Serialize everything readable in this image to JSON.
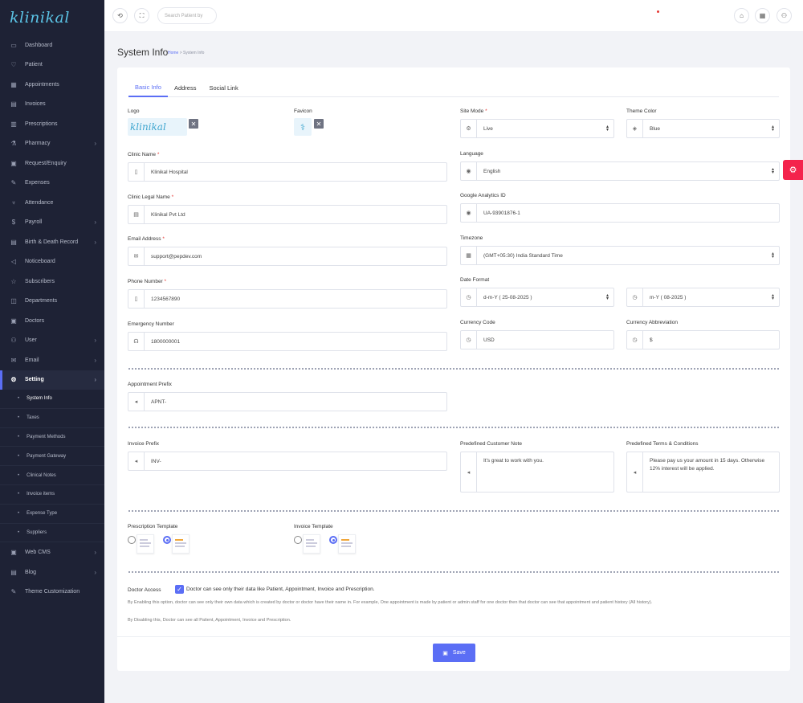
{
  "brand": {
    "name": "klinikal"
  },
  "sidebar": {
    "items": [
      {
        "label": "Dashboard",
        "icon": "monitor-icon",
        "glyph": "▭"
      },
      {
        "label": "Patient",
        "icon": "heart-icon",
        "glyph": "♡"
      },
      {
        "label": "Appointments",
        "icon": "calendar-icon",
        "glyph": "▦"
      },
      {
        "label": "Invoices",
        "icon": "invoice-icon",
        "glyph": "▤"
      },
      {
        "label": "Prescriptions",
        "icon": "prescription-icon",
        "glyph": "▥"
      },
      {
        "label": "Pharmacy",
        "icon": "pharmacy-icon",
        "glyph": "⚗",
        "chevron": true
      },
      {
        "label": "Request/Enquiry",
        "icon": "request-icon",
        "glyph": "▣"
      },
      {
        "label": "Expenses",
        "icon": "expenses-icon",
        "glyph": "✎"
      },
      {
        "label": "Attendance",
        "icon": "attendance-icon",
        "glyph": "♆"
      },
      {
        "label": "Payroll",
        "icon": "dollar-icon",
        "glyph": "$",
        "chevron": true
      },
      {
        "label": "Birth & Death Record",
        "icon": "record-icon",
        "glyph": "▤",
        "chevron": true
      },
      {
        "label": "Noticeboard",
        "icon": "megaphone-icon",
        "glyph": "◁"
      },
      {
        "label": "Subscribers",
        "icon": "star-icon",
        "glyph": "☆"
      },
      {
        "label": "Departments",
        "icon": "departments-icon",
        "glyph": "◫"
      },
      {
        "label": "Doctors",
        "icon": "doctor-icon",
        "glyph": "▣"
      },
      {
        "label": "User",
        "icon": "user-icon",
        "glyph": "⚇",
        "chevron": true
      },
      {
        "label": "Email",
        "icon": "mail-icon",
        "glyph": "✉",
        "chevron": true
      },
      {
        "label": "Setting",
        "icon": "gear-icon",
        "glyph": "⚙",
        "chevron": true,
        "active": true
      }
    ],
    "subitems": [
      "System Info",
      "Taxes",
      "Payment Methods",
      "Payment Gateway",
      "Clinical Notes",
      "Invoice items",
      "Expense Type",
      "Suppliers"
    ],
    "items_after": [
      {
        "label": "Web CMS",
        "icon": "web-icon",
        "glyph": "▣",
        "chevron": true
      },
      {
        "label": "Blog",
        "icon": "blog-icon",
        "glyph": "▤",
        "chevron": true
      },
      {
        "label": "Theme Customization",
        "icon": "theme-icon",
        "glyph": "✎"
      }
    ]
  },
  "topbar": {
    "search_placeholder": "Search Patient by"
  },
  "page": {
    "title": "System Info",
    "breadcrumb_home": "Home",
    "breadcrumb_sep": ">",
    "breadcrumb_current": "System Info"
  },
  "tabs": [
    "Basic Info",
    "Address",
    "Social Link"
  ],
  "form": {
    "logo_label": "Logo",
    "favicon_label": "Favicon",
    "site_mode_label": "Site Mode",
    "site_mode_value": "Live",
    "theme_color_label": "Theme Color",
    "theme_color_value": "Blue",
    "clinic_name_label": "Clinic Name",
    "clinic_name_value": "Klinikal Hospital",
    "language_label": "Language",
    "language_value": "English",
    "clinic_legal_label": "Clinic Legal Name",
    "clinic_legal_value": "Klinikal Pvt Ltd",
    "ga_label": "Google Analytics ID",
    "ga_value": "UA-93901876-1",
    "email_label": "Email Address",
    "email_value": "support@pepdev.com",
    "timezone_label": "Timezone",
    "timezone_value": "(GMT+05:30) India Standard Time",
    "phone_label": "Phone Number",
    "phone_value": "1234567890",
    "date_format_label": "Date Format",
    "date_format_value": "d-m-Y ( 25-08-2025 )",
    "date_format2_value": "m-Y ( 08-2025 )",
    "emergency_label": "Emergency Number",
    "emergency_value": "1800000001",
    "currency_code_label": "Currency Code",
    "currency_code_value": "USD",
    "currency_abbr_label": "Currency Abbreviation",
    "currency_abbr_value": "$",
    "appt_prefix_label": "Appointment Prefix",
    "appt_prefix_value": "APNT-",
    "invoice_prefix_label": "Invoice Prefix",
    "invoice_prefix_value": "INV-",
    "customer_note_label": "Predefined Customer Note",
    "customer_note_value": "It's great to work with you.",
    "terms_label": "Predefined Terms & Conditions",
    "terms_value": "Please pay us your amount in 15 days. Otherwise 12% interest will be applied.",
    "prescription_template_label": "Prescription Template",
    "invoice_template_label": "Invoice Template",
    "doctor_access_label": "Doctor Access",
    "doctor_access_check": "Doctor can see only their data like Patient, Appointment, Invoice and Prescription.",
    "help_enable": "By Enabling this option, doctor can see only their own data which is created by doctor or doctor have their name in. For example, One appointment is made by patient or admin staff for one doctor then that doctor can see that appointment and patient history (All history).",
    "help_disable": "By Disabling this, Doctor can see all Patient, Appointment, Invoice and Prescription.",
    "required_mark": "*"
  },
  "save_label": "Save",
  "colors": {
    "accent": "#5b6ef5",
    "sidebar": "#1e2235",
    "danger": "#f4234c"
  }
}
